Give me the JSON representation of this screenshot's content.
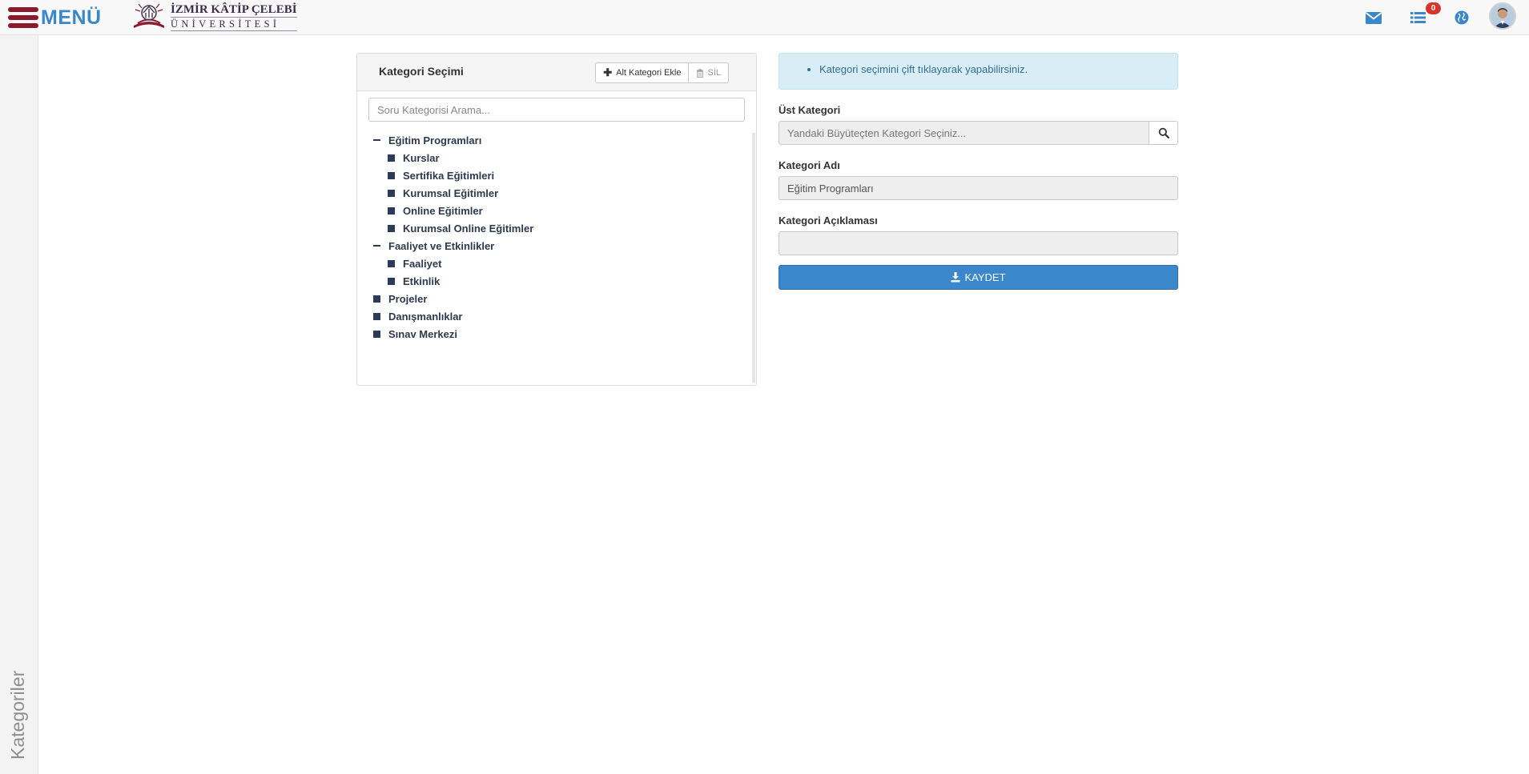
{
  "header": {
    "menu_label": "MENÜ",
    "logo": {
      "line1": "İZMİR KÂTİP ÇELEBİ",
      "line2": "ÜNİVERSİTESİ"
    },
    "icons": [
      "envelope-icon",
      "list-icon",
      "globe-icon"
    ],
    "notification_count": "0"
  },
  "sidebar": {
    "title": "Kategoriler"
  },
  "category_panel": {
    "title": "Kategori Seçimi",
    "add_button_label": "Alt Kategori Ekle",
    "delete_button_label": "SİL",
    "search_placeholder": "Soru Kategorisi Arama...",
    "tree": [
      {
        "label": "Eğitim Programları",
        "level": 1,
        "expanded": true
      },
      {
        "label": "Kurslar",
        "level": 2
      },
      {
        "label": "Sertifika Eğitimleri",
        "level": 2
      },
      {
        "label": "Kurumsal Eğitimler",
        "level": 2
      },
      {
        "label": "Online Eğitimler",
        "level": 2
      },
      {
        "label": "Kurumsal Online Eğitimler",
        "level": 2
      },
      {
        "label": "Faaliyet ve Etkinlikler",
        "level": 1,
        "expanded": true
      },
      {
        "label": "Faaliyet",
        "level": 2
      },
      {
        "label": "Etkinlik",
        "level": 2
      },
      {
        "label": "Projeler",
        "level": 1
      },
      {
        "label": "Danışmanlıklar",
        "level": 1
      },
      {
        "label": "Sınav Merkezi",
        "level": 1
      }
    ]
  },
  "form": {
    "info_message": "Kategori seçimini çift tıklayarak yapabilirsiniz.",
    "parent_label": "Üst Kategori",
    "parent_placeholder": "Yandaki Büyüteçten Kategori Seçiniz...",
    "name_label": "Kategori Adı",
    "name_value": "Eğitim Programları",
    "description_label": "Kategori Açıklaması",
    "description_value": "",
    "save_label": "KAYDET"
  },
  "colors": {
    "brand_red": "#8b1a2b",
    "primary_blue": "#3a87cc",
    "badge_red": "#d9342b",
    "info_bg": "#d9edf7",
    "tree_navy": "#2c3b5a"
  }
}
